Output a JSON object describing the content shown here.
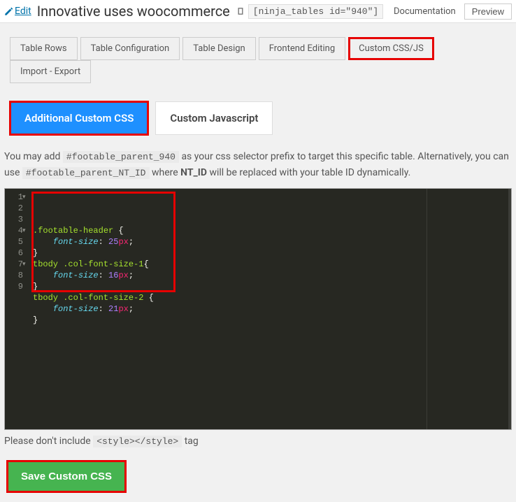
{
  "header": {
    "edit_label": "Edit",
    "title": "Innovative uses woocommerce",
    "shortcode": "[ninja_tables id=\"940\"]",
    "documentation_label": "Documentation",
    "preview_label": "Preview"
  },
  "tabs": [
    {
      "label": "Table Rows"
    },
    {
      "label": "Table Configuration"
    },
    {
      "label": "Table Design"
    },
    {
      "label": "Frontend Editing"
    },
    {
      "label": "Custom CSS/JS"
    },
    {
      "label": "Import - Export"
    }
  ],
  "sub_tabs": {
    "css": "Additional Custom CSS",
    "js": "Custom Javascript"
  },
  "description": {
    "prefix": "You may add",
    "selector1": "#footable_parent_940",
    "mid": "as your css selector prefix to target this specific table. Alternatively, you can use",
    "selector2": "#footable_parent_NT_ID",
    "suffix1": "where",
    "nt_id": "NT_ID",
    "suffix2": "will be replaced with your table ID dynamically."
  },
  "code": {
    "lines": [
      {
        "n": 1,
        "fold": true,
        "sel": ".footable-header",
        "brace": " {"
      },
      {
        "n": 2,
        "indent": true,
        "prop": "font-size",
        "num": "25",
        "unit": "px"
      },
      {
        "n": 3,
        "close": "}"
      },
      {
        "n": 4,
        "fold": true,
        "sel": "tbody .col-font-size-1",
        "brace": "{"
      },
      {
        "n": 5,
        "indent": true,
        "prop": "font-size",
        "num": "16",
        "unit": "px"
      },
      {
        "n": 6,
        "close": "}"
      },
      {
        "n": 7,
        "fold": true,
        "sel": "tbody .col-font-size-2",
        "brace": " {"
      },
      {
        "n": 8,
        "indent": true,
        "prop": "font-size",
        "num": "21",
        "unit": "px"
      },
      {
        "n": 9,
        "close": "}"
      }
    ]
  },
  "note": {
    "prefix": "Please don't include",
    "tag": "<style></style>",
    "suffix": "tag"
  },
  "save_label": "Save Custom CSS"
}
